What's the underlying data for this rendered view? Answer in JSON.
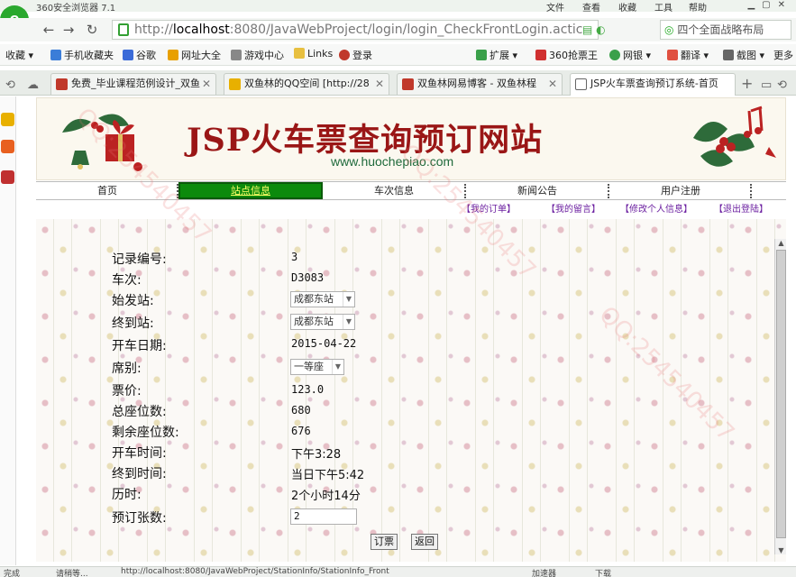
{
  "browser": {
    "app_title": "360安全浏览器 7.1",
    "menu": [
      "文件",
      "查看",
      "收藏",
      "工具",
      "帮助"
    ],
    "address": {
      "scheme": "http://",
      "host": "localhost",
      "path": ":8080/JavaWebProject/login/login_CheckFrontLogin.actic"
    },
    "search_placeholder": "四个全面战略布局",
    "bookmarks": [
      "收藏",
      "手机收藏夹",
      "谷歌",
      "网址大全",
      "游戏中心",
      "Links",
      "登录",
      "扩展",
      "360抢票王",
      "网银",
      "翻译",
      "截图",
      "更多"
    ],
    "tabs": [
      {
        "label": "免费_毕业课程范例设计_双鱼",
        "fav_color": "#c0392b"
      },
      {
        "label": "双鱼林的QQ空间 [http://28",
        "fav_color": "#e8b000"
      },
      {
        "label": "双鱼林网易博客 - 双鱼林程",
        "fav_color": "#c0392b"
      },
      {
        "label": "JSP火车票查询预订系统-首页",
        "fav_color": "#666666"
      }
    ],
    "status": {
      "left": "完成",
      "loading": "请稍等...",
      "url": "http://localhost:8080/JavaWebProject/StationInfo/StationInfo_Front",
      "accelerator": "加速器",
      "download": "下载"
    }
  },
  "site": {
    "title": "JSP火车票查询预订网站",
    "domain": "www.huochepiao.com",
    "nav": [
      "首页",
      "站点信息",
      "车次信息",
      "新闻公告",
      "用户注册"
    ],
    "user_links": [
      "【我的订单】",
      "【我的留言】",
      "【修改个人信息】",
      "【退出登陆】"
    ]
  },
  "form": {
    "fields": [
      {
        "label": "记录编号:",
        "value": "3",
        "kind": "text"
      },
      {
        "label": "车次:",
        "value": "D3083",
        "kind": "text"
      },
      {
        "label": "始发站:",
        "value": "成都东站",
        "kind": "select"
      },
      {
        "label": "终到站:",
        "value": "成都东站",
        "kind": "select"
      },
      {
        "label": "开车日期:",
        "value": "2015-04-22",
        "kind": "text"
      },
      {
        "label": "席别:",
        "value": "一等座",
        "kind": "select"
      },
      {
        "label": "票价:",
        "value": "123.0",
        "kind": "text"
      },
      {
        "label": "总座位数:",
        "value": "680",
        "kind": "text"
      },
      {
        "label": "剩余座位数:",
        "value": "676",
        "kind": "text"
      },
      {
        "label": "开车时间:",
        "value": "下午3:28",
        "kind": "cn"
      },
      {
        "label": "终到时间:",
        "value": "当日下午5:42",
        "kind": "cn"
      },
      {
        "label": "历时:",
        "value": "2个小时14分",
        "kind": "cn"
      },
      {
        "label": "预订张数:",
        "value": "2",
        "kind": "input"
      }
    ],
    "book_button": "订票",
    "back_button": "返回"
  },
  "colors": {
    "nav_active_bg": "#0c8a0c",
    "nav_active_text": "#ffff66",
    "banner_title": "#9a1616",
    "user_link": "#6b1fa0"
  }
}
